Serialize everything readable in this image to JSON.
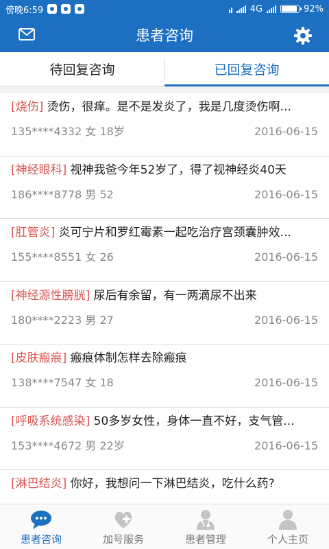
{
  "status_bar": {
    "time": "傍晚6:59",
    "network": "4G",
    "battery": "92%",
    "battery_level": 0.92
  },
  "header": {
    "title": "患者咨询",
    "left_icon": "mail-icon",
    "right_icon": "gear-icon"
  },
  "tabs": [
    {
      "label": "待回复咨询",
      "active": false
    },
    {
      "label": "已回复咨询",
      "active": true
    }
  ],
  "consultations": [
    {
      "tag": "[烧伤]",
      "question": "烫伤，很痒。是不是发炎了，我是几度烫伤啊...",
      "phone": "135****4332",
      "gender": "女",
      "age": "18岁",
      "date": "2016-06-15"
    },
    {
      "tag": "[神经眼科]",
      "question": "视神我爸今年52岁了，得了视神经炎40天",
      "phone": "186****8778",
      "gender": "男",
      "age": "52",
      "date": "2016-06-15"
    },
    {
      "tag": "[肛管炎]",
      "question": "炎可宁片和罗红霉素一起吃治疗宫颈囊肿效...",
      "phone": "155****8551",
      "gender": "女",
      "age": "26",
      "date": "2016-06-15"
    },
    {
      "tag": "[神经源性膀胱]",
      "question": "尿后有余留，有一两滴尿不出来",
      "phone": "180****2223",
      "gender": "男",
      "age": "27",
      "date": "2016-06-15"
    },
    {
      "tag": "[皮肤瘢痕]",
      "question": "瘢痕体制怎样去除瘢痕",
      "phone": "138****7547",
      "gender": "女",
      "age": "18",
      "date": "2016-06-15"
    },
    {
      "tag": "[呼吸系统感染]",
      "question": "50多岁女性，身体一直不好，支气管...",
      "phone": "153****4672",
      "gender": "男",
      "age": "22岁",
      "date": "2016-06-15"
    },
    {
      "tag": "[淋巴结炎]",
      "question": "你好，我想问一下淋巴结炎，吃什么药?",
      "phone": "",
      "gender": "",
      "age": "",
      "date": ""
    }
  ],
  "bottom_nav": [
    {
      "label": "患者咨询",
      "icon": "chat-bubble-icon",
      "active": true
    },
    {
      "label": "加号服务",
      "icon": "heart-plus-icon",
      "active": false
    },
    {
      "label": "患者管理",
      "icon": "doctor-icon",
      "active": false
    },
    {
      "label": "个人主页",
      "icon": "person-icon",
      "active": false
    }
  ],
  "colors": {
    "primary": "#1c6fc1",
    "tag": "#d9534f"
  }
}
